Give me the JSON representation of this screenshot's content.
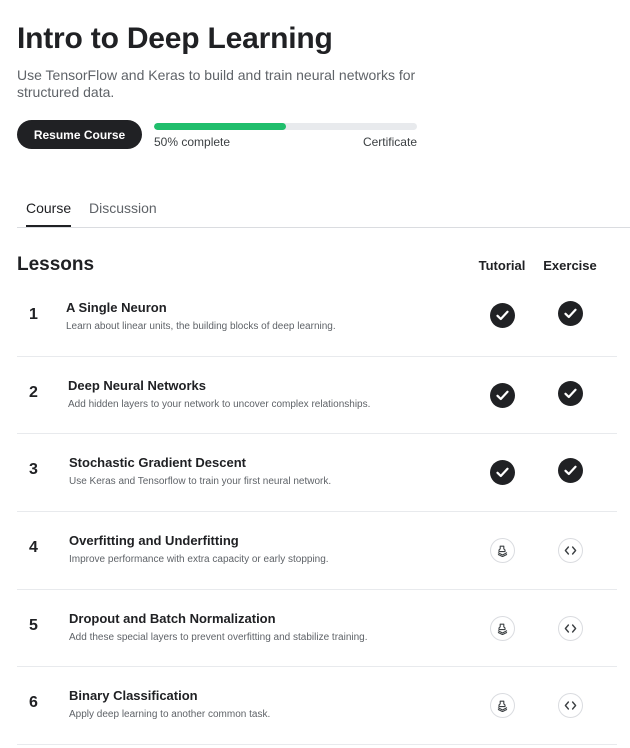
{
  "course": {
    "title": "Intro to Deep Learning",
    "subtitle": "Use TensorFlow and Keras to build and train neural networks for structured data.",
    "resume_label": "Resume Course",
    "progress_percent": 50,
    "progress_label": "50% complete",
    "certificate_label": "Certificate"
  },
  "colors": {
    "progress": "#20be6c",
    "dark": "#202124"
  },
  "tabs": [
    {
      "label": "Course",
      "active": true
    },
    {
      "label": "Discussion",
      "active": false
    }
  ],
  "lessons_section": {
    "heading": "Lessons",
    "tutorial_header": "Tutorial",
    "exercise_header": "Exercise"
  },
  "lessons": [
    {
      "number": "1",
      "title": "A Single Neuron",
      "description": "Learn about linear units, the building blocks of deep learning.",
      "tutorial_done": true,
      "exercise_done": true
    },
    {
      "number": "2",
      "title": "Deep Neural Networks",
      "description": "Add hidden layers to your network to uncover complex relationships.",
      "tutorial_done": true,
      "exercise_done": true
    },
    {
      "number": "3",
      "title": "Stochastic Gradient Descent",
      "description": "Use Keras and Tensorflow to train your first neural network.",
      "tutorial_done": true,
      "exercise_done": true
    },
    {
      "number": "4",
      "title": "Overfitting and Underfitting",
      "description": "Improve performance with extra capacity or early stopping.",
      "tutorial_done": false,
      "exercise_done": false
    },
    {
      "number": "5",
      "title": "Dropout and Batch Normalization",
      "description": "Add these special layers to prevent overfitting and stabilize training.",
      "tutorial_done": false,
      "exercise_done": false
    },
    {
      "number": "6",
      "title": "Binary Classification",
      "description": "Apply deep learning to another common task.",
      "tutorial_done": false,
      "exercise_done": false
    }
  ]
}
